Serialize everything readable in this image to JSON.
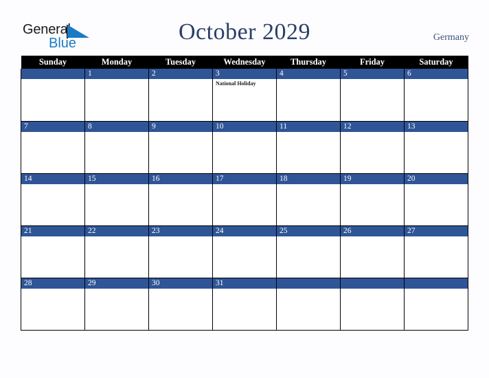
{
  "brand": {
    "word_one": "General",
    "word_two": "Blue",
    "triangle_icon": "triangle-logo-icon",
    "accent_black": "#1a1a1a",
    "accent_blue": "#1b7ac4"
  },
  "header": {
    "title": "October 2029",
    "country": "Germany",
    "title_color": "#2b3f66"
  },
  "theme": {
    "daybar_blue": "#2f5597",
    "weekday_header_bg": "#000000",
    "weekday_header_fg": "#ffffff",
    "cell_bg": "#ffffff",
    "grid_line": "#000000",
    "page_bg": "#fdfdff"
  },
  "calendar": {
    "weekdays": [
      "Sunday",
      "Monday",
      "Tuesday",
      "Wednesday",
      "Thursday",
      "Friday",
      "Saturday"
    ],
    "weeks": [
      [
        {
          "day": "",
          "events": []
        },
        {
          "day": "1",
          "events": []
        },
        {
          "day": "2",
          "events": []
        },
        {
          "day": "3",
          "events": [
            "National Holiday"
          ]
        },
        {
          "day": "4",
          "events": []
        },
        {
          "day": "5",
          "events": []
        },
        {
          "day": "6",
          "events": []
        }
      ],
      [
        {
          "day": "7",
          "events": []
        },
        {
          "day": "8",
          "events": []
        },
        {
          "day": "9",
          "events": []
        },
        {
          "day": "10",
          "events": []
        },
        {
          "day": "11",
          "events": []
        },
        {
          "day": "12",
          "events": []
        },
        {
          "day": "13",
          "events": []
        }
      ],
      [
        {
          "day": "14",
          "events": []
        },
        {
          "day": "15",
          "events": []
        },
        {
          "day": "16",
          "events": []
        },
        {
          "day": "17",
          "events": []
        },
        {
          "day": "18",
          "events": []
        },
        {
          "day": "19",
          "events": []
        },
        {
          "day": "20",
          "events": []
        }
      ],
      [
        {
          "day": "21",
          "events": []
        },
        {
          "day": "22",
          "events": []
        },
        {
          "day": "23",
          "events": []
        },
        {
          "day": "24",
          "events": []
        },
        {
          "day": "25",
          "events": []
        },
        {
          "day": "26",
          "events": []
        },
        {
          "day": "27",
          "events": []
        }
      ],
      [
        {
          "day": "28",
          "events": []
        },
        {
          "day": "29",
          "events": []
        },
        {
          "day": "30",
          "events": []
        },
        {
          "day": "31",
          "events": []
        },
        {
          "day": "",
          "events": []
        },
        {
          "day": "",
          "events": []
        },
        {
          "day": "",
          "events": []
        }
      ]
    ]
  }
}
